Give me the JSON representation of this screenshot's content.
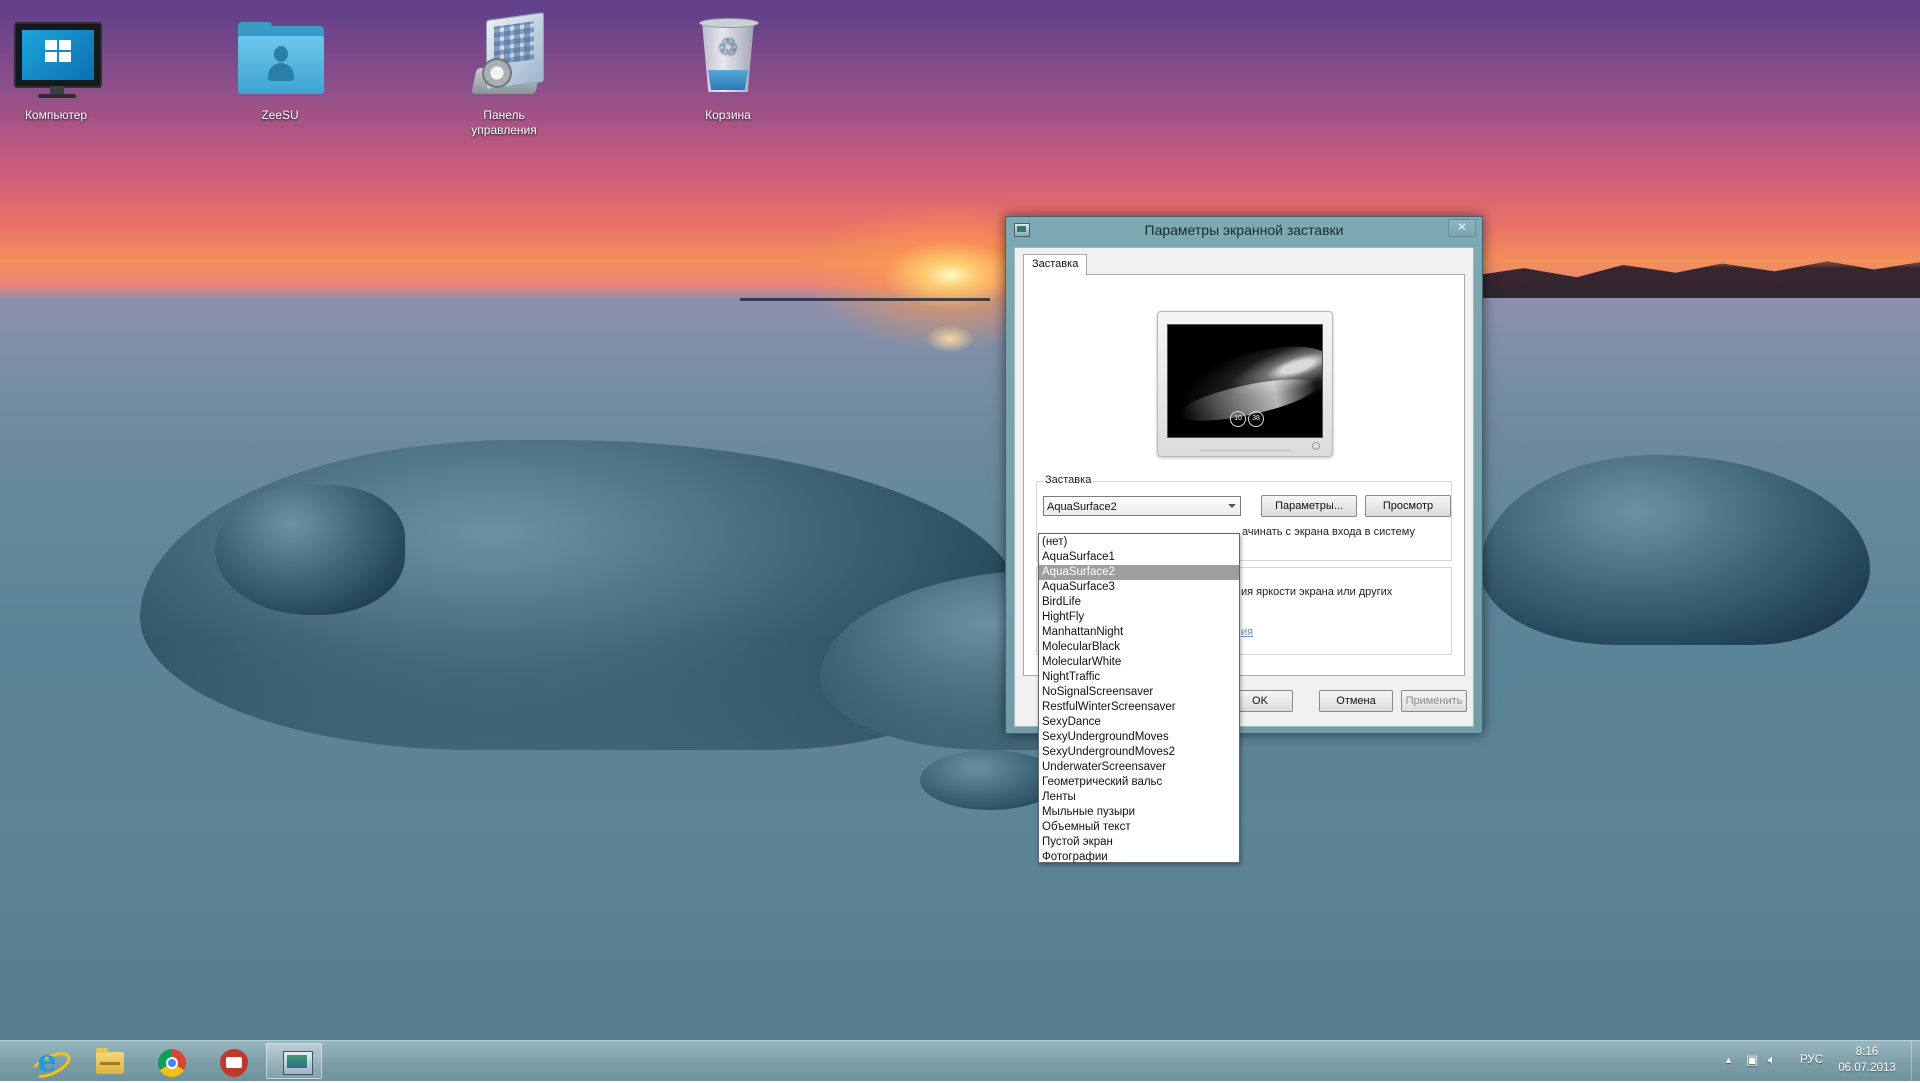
{
  "desktop": {
    "icons": [
      {
        "label": "Компьютер",
        "icon": "computer-icon"
      },
      {
        "label": "ZeeSU",
        "icon": "user-folder-icon"
      },
      {
        "label": "Панель управления",
        "icon": "control-panel-icon"
      },
      {
        "label": "Корзина",
        "icon": "recycle-bin-icon"
      }
    ]
  },
  "dialog": {
    "title": "Параметры экранной заставки",
    "close_label": "✕",
    "tab": "Заставка",
    "preview": {
      "clock_hours": "10",
      "clock_minutes": "38"
    },
    "screensaver_group": {
      "label": "Заставка",
      "selected": "AquaSurface2",
      "params_button": "Параметры...",
      "preview_button": "Просмотр",
      "login_text": "ачинать с экрана входа в систему"
    },
    "power_group": {
      "text": "ия яркости экрана или других",
      "link": "ия"
    },
    "ok_button": "OK",
    "cancel_button": "Отмена",
    "apply_button": "Применить"
  },
  "dropdown": {
    "options": [
      "(нет)",
      "AquaSurface1",
      "AquaSurface2",
      "AquaSurface3",
      "BirdLife",
      "HightFly",
      "ManhattanNight",
      "MolecularBlack",
      "MolecularWhite",
      "NightTraffic",
      "NoSignalScreensaver",
      "RestfulWinterScreensaver",
      "SexyDance",
      "SexyUndergroundMoves",
      "SexyUndergroundMoves2",
      "UnderwaterScreensaver",
      "Геометрический вальс",
      "Ленты",
      "Мыльные пузыри",
      "Объемный текст",
      "Пустой экран",
      "Фотографии"
    ],
    "selected_index": 2
  },
  "taskbar": {
    "pinned": [
      {
        "name": "internet-explorer",
        "icon": "internet-explorer-icon"
      },
      {
        "name": "file-explorer",
        "icon": "folder-icon"
      },
      {
        "name": "chrome",
        "icon": "chrome-icon"
      },
      {
        "name": "screenshot-app",
        "icon": "camera-icon"
      },
      {
        "name": "screensaver-settings",
        "icon": "screensaver-icon",
        "active": true
      }
    ],
    "tray": {
      "chevron": "▲",
      "language": "РУС",
      "time": "8:16",
      "date": "06.07.2013"
    }
  },
  "colors": {
    "dialog_frame": "#7ea8b2",
    "taskbar": "#7c9ea8",
    "selection": "#9e9e9e"
  }
}
